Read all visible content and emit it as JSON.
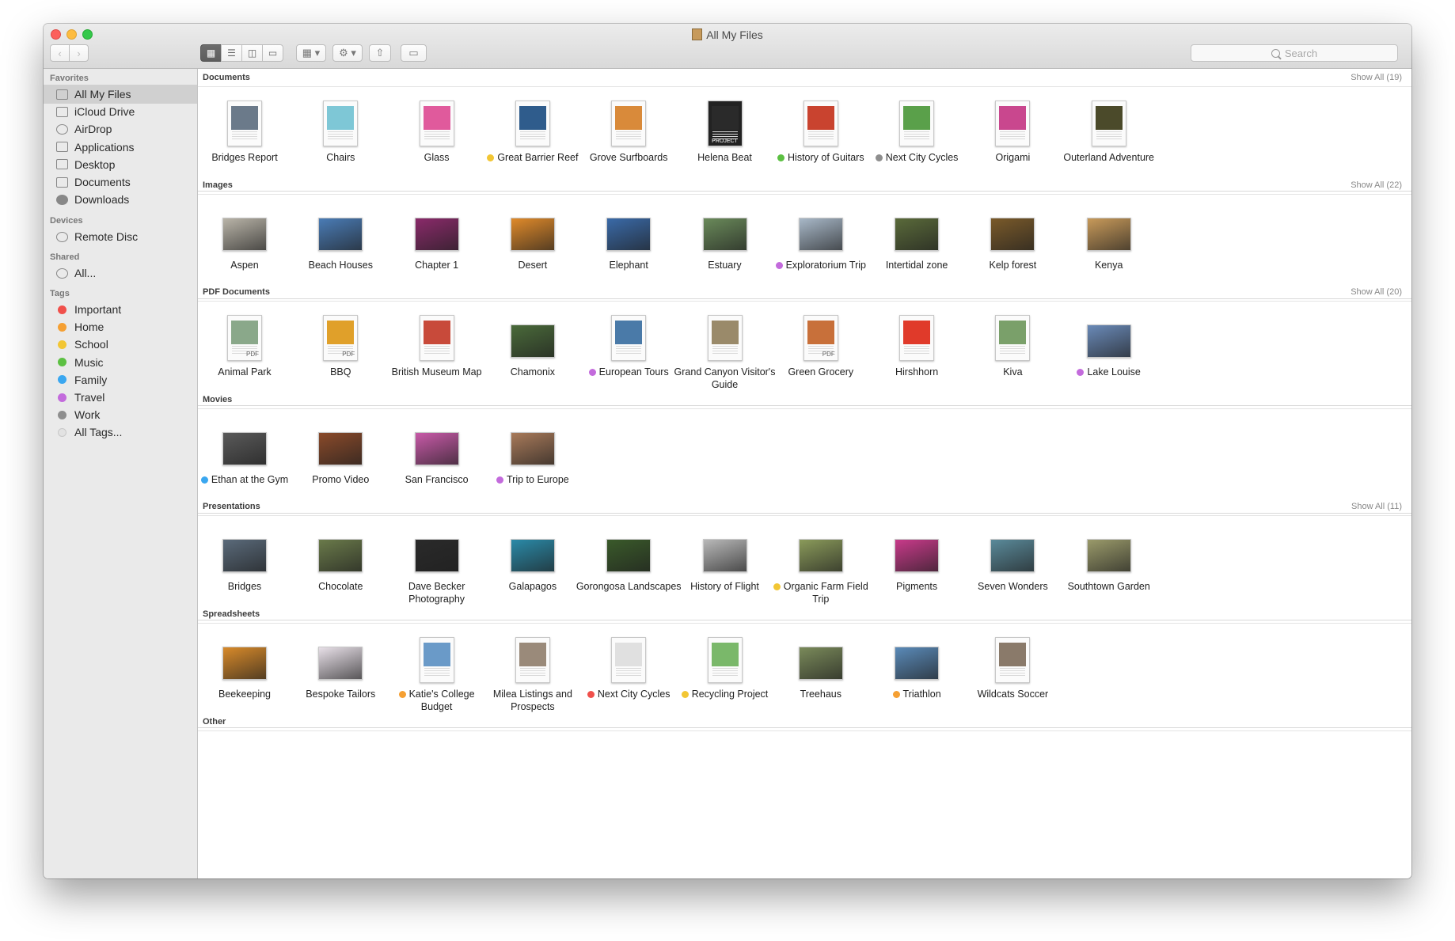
{
  "window": {
    "title": "All My Files"
  },
  "toolbar": {
    "back_icon": "chevron-left-icon",
    "forward_icon": "chevron-right-icon",
    "view_modes": [
      "icon-view",
      "list-view",
      "column-view",
      "cover-flow-view"
    ],
    "active_view": "icon-view",
    "search_placeholder": "Search"
  },
  "sidebar": {
    "favorites_label": "Favorites",
    "favorites": [
      {
        "label": "All My Files",
        "icon": "all-my-files-icon",
        "selected": true
      },
      {
        "label": "iCloud Drive",
        "icon": "cloud-icon"
      },
      {
        "label": "AirDrop",
        "icon": "airdrop-icon"
      },
      {
        "label": "Applications",
        "icon": "applications-icon"
      },
      {
        "label": "Desktop",
        "icon": "desktop-icon"
      },
      {
        "label": "Documents",
        "icon": "documents-icon"
      },
      {
        "label": "Downloads",
        "icon": "downloads-icon"
      }
    ],
    "devices_label": "Devices",
    "devices": [
      {
        "label": "Remote Disc",
        "icon": "disc-icon"
      }
    ],
    "shared_label": "Shared",
    "shared": [
      {
        "label": "All...",
        "icon": "network-icon"
      }
    ],
    "tags_label": "Tags",
    "tags": [
      {
        "label": "Important",
        "color": "#f0504b"
      },
      {
        "label": "Home",
        "color": "#f5a033"
      },
      {
        "label": "School",
        "color": "#f2c634"
      },
      {
        "label": "Music",
        "color": "#5cc042"
      },
      {
        "label": "Family",
        "color": "#3aa7f0"
      },
      {
        "label": "Travel",
        "color": "#c36bdc"
      },
      {
        "label": "Work",
        "color": "#8e8e8e"
      },
      {
        "label": "All Tags...",
        "color": "#e2e2e2"
      }
    ]
  },
  "sections": [
    {
      "title": "Documents",
      "show_all": "Show All (19)",
      "items": [
        {
          "name": "Bridges Report",
          "kind": "doc",
          "color": "#6b7a8a"
        },
        {
          "name": "Chairs",
          "kind": "doc",
          "color": "#7ec7d6"
        },
        {
          "name": "Glass",
          "kind": "doc",
          "color": "#e05a9c"
        },
        {
          "name": "Great Barrier Reef",
          "kind": "doc",
          "color": "#2f5c8c",
          "tag": "#f2c634"
        },
        {
          "name": "Grove Surfboards",
          "kind": "doc",
          "color": "#d98a3a"
        },
        {
          "name": "Helena Beat",
          "kind": "doc",
          "color": "#2a2a2a",
          "badge": "PROJECT"
        },
        {
          "name": "History of Guitars",
          "kind": "doc",
          "color": "#c9432f",
          "tag": "#5cc042"
        },
        {
          "name": "Next City Cycles",
          "kind": "doc",
          "color": "#5aa04a",
          "tag": "#8e8e8e"
        },
        {
          "name": "Origami",
          "kind": "doc",
          "color": "#c9478e"
        },
        {
          "name": "Outerland Adventure",
          "kind": "doc",
          "color": "#4b4a2a"
        }
      ]
    },
    {
      "title": "Images",
      "show_all": "Show All (22)",
      "items": [
        {
          "name": "Aspen",
          "kind": "wide",
          "color": "#b9b4a8"
        },
        {
          "name": "Beach Houses",
          "kind": "wide",
          "color": "#4a7cb6"
        },
        {
          "name": "Chapter 1",
          "kind": "wide",
          "color": "#8a2a6a"
        },
        {
          "name": "Desert",
          "kind": "wide",
          "color": "#e08a2a"
        },
        {
          "name": "Elephant",
          "kind": "wide",
          "color": "#3a6aa8"
        },
        {
          "name": "Estuary",
          "kind": "wide",
          "color": "#6a8a5a"
        },
        {
          "name": "Exploratorium Trip",
          "kind": "wide",
          "color": "#a8b8c8",
          "tag": "#c36bdc"
        },
        {
          "name": "Intertidal zone",
          "kind": "wide",
          "color": "#5a6a3a"
        },
        {
          "name": "Kelp forest",
          "kind": "wide",
          "color": "#7a5a2a"
        },
        {
          "name": "Kenya",
          "kind": "wide",
          "color": "#c89a5a"
        }
      ]
    },
    {
      "title": "PDF Documents",
      "show_all": "Show All (20)",
      "items": [
        {
          "name": "Animal Park",
          "kind": "doc",
          "color": "#8aa88a",
          "badge": "PDF"
        },
        {
          "name": "BBQ",
          "kind": "doc",
          "color": "#e0a02a",
          "badge": "PDF"
        },
        {
          "name": "British Museum Map",
          "kind": "doc",
          "color": "#c84a3a"
        },
        {
          "name": "Chamonix",
          "kind": "wide",
          "color": "#4a6a3a"
        },
        {
          "name": "European Tours",
          "kind": "doc",
          "color": "#4a7aa8",
          "tag": "#c36bdc"
        },
        {
          "name": "Grand Canyon Visitor's Guide",
          "kind": "doc",
          "color": "#9a8a6a"
        },
        {
          "name": "Green Grocery",
          "kind": "doc",
          "color": "#c8703a",
          "badge": "PDF"
        },
        {
          "name": "Hirshhorn",
          "kind": "doc",
          "color": "#e03a2a"
        },
        {
          "name": "Kiva",
          "kind": "doc",
          "color": "#7aa06a"
        },
        {
          "name": "Lake Louise",
          "kind": "wide",
          "color": "#6a8ab8",
          "tag": "#c36bdc"
        }
      ]
    },
    {
      "title": "Movies",
      "show_all": "",
      "items": [
        {
          "name": "Ethan at the Gym",
          "kind": "wide",
          "color": "#5a5a5a",
          "tag": "#3aa7f0"
        },
        {
          "name": "Promo Video",
          "kind": "wide",
          "color": "#8a4a2a"
        },
        {
          "name": "San Francisco",
          "kind": "wide",
          "color": "#c85aa8"
        },
        {
          "name": "Trip to Europe",
          "kind": "wide",
          "color": "#a87a5a",
          "tag": "#c36bdc"
        }
      ]
    },
    {
      "title": "Presentations",
      "show_all": "Show All (11)",
      "items": [
        {
          "name": "Bridges",
          "kind": "wide",
          "color": "#5a6a7a"
        },
        {
          "name": "Chocolate",
          "kind": "wide",
          "color": "#6a7a4a"
        },
        {
          "name": "Dave Becker Photography",
          "kind": "wide",
          "color": "#2a2a2a"
        },
        {
          "name": "Galapagos",
          "kind": "wide",
          "color": "#2a8aa8"
        },
        {
          "name": "Gorongosa Landscapes",
          "kind": "wide",
          "color": "#3a5a2a"
        },
        {
          "name": "History of Flight",
          "kind": "wide",
          "color": "#b8b8b8"
        },
        {
          "name": "Organic Farm Field Trip",
          "kind": "wide",
          "color": "#8a9a5a",
          "tag": "#f2c634"
        },
        {
          "name": "Pigments",
          "kind": "wide",
          "color": "#c83a8a"
        },
        {
          "name": "Seven Wonders",
          "kind": "wide",
          "color": "#5a8a9a"
        },
        {
          "name": "Southtown Garden",
          "kind": "wide",
          "color": "#9a9a6a"
        }
      ]
    },
    {
      "title": "Spreadsheets",
      "show_all": "",
      "items": [
        {
          "name": "Beekeeping",
          "kind": "wide",
          "color": "#d88a2a"
        },
        {
          "name": "Bespoke Tailors",
          "kind": "wide",
          "color": "#e8e0e8"
        },
        {
          "name": "Katie's College Budget",
          "kind": "doc",
          "color": "#6a9ac8",
          "tag": "#f5a033"
        },
        {
          "name": "Milea Listings and Prospects",
          "kind": "doc",
          "color": "#9a8a7a"
        },
        {
          "name": "Next City Cycles",
          "kind": "doc",
          "color": "#e0e0e0",
          "tag": "#f0504b"
        },
        {
          "name": "Recycling Project",
          "kind": "doc",
          "color": "#7ab86a",
          "tag": "#f2c634"
        },
        {
          "name": "Treehaus",
          "kind": "wide",
          "color": "#7a8a5a"
        },
        {
          "name": "Triathlon",
          "kind": "wide",
          "color": "#5a8ab8",
          "tag": "#f5a033"
        },
        {
          "name": "Wildcats Soccer",
          "kind": "doc",
          "color": "#8a7a6a"
        }
      ]
    },
    {
      "title": "Other",
      "show_all": "",
      "items": []
    }
  ]
}
